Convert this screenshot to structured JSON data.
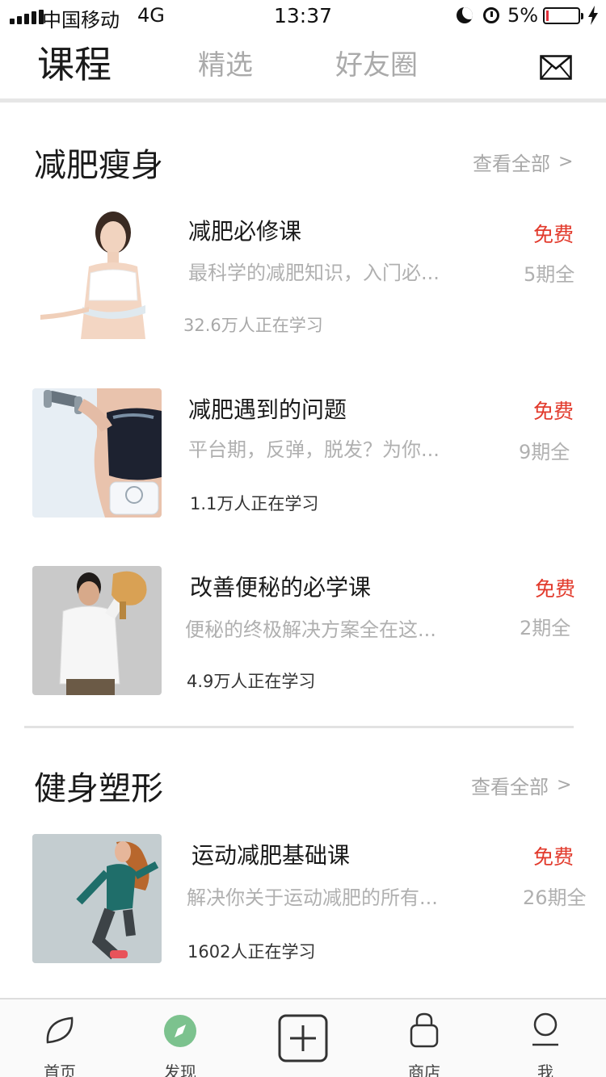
{
  "status_bar": {
    "carrier": "中国移动",
    "network": "4G",
    "time": "13:37",
    "battery_percent": "5%",
    "icons": [
      "signal-bars-icon",
      "moon-icon",
      "alarm-icon",
      "battery-icon",
      "charging-bolt-icon"
    ]
  },
  "top_nav": {
    "tabs": [
      {
        "label": "课程",
        "active": true
      },
      {
        "label": "精选",
        "active": false
      },
      {
        "label": "好友圈",
        "active": false
      }
    ],
    "mail_icon": "envelope-icon"
  },
  "sections": [
    {
      "title": "减肥瘦身",
      "see_all": "查看全部",
      "see_all_chevron": ">",
      "courses": [
        {
          "title": "减肥必修课",
          "desc": "最科学的减肥知识，入门必...",
          "learners": "32.6万人正在学习",
          "price": "免费",
          "episodes": "5期全"
        },
        {
          "title": "减肥遇到的问题",
          "desc": "平台期，反弹，脱发？为你...",
          "learners": "1.1万人正在学习",
          "price": "免费",
          "episodes": "9期全"
        },
        {
          "title": "改善便秘的必学课",
          "desc": "便秘的终极解决方案全在这...",
          "learners": "4.9万人正在学习",
          "price": "免费",
          "episodes": "2期全"
        }
      ]
    },
    {
      "title": "健身塑形",
      "see_all": "查看全部",
      "see_all_chevron": ">",
      "courses": [
        {
          "title": "运动减肥基础课",
          "desc": "解决你关于运动减肥的所有...",
          "learners": "1602人正在学习",
          "price": "免费",
          "episodes": "26期全"
        }
      ]
    }
  ],
  "bottom_nav": {
    "items": [
      {
        "label": "首页",
        "icon": "leaf-icon"
      },
      {
        "label": "发现",
        "icon": "compass-icon",
        "active": true
      },
      {
        "label": "",
        "icon": "plus-icon"
      },
      {
        "label": "商店",
        "icon": "shopping-bag-icon"
      },
      {
        "label": "我",
        "icon": "user-icon"
      }
    ]
  },
  "colors": {
    "accent_red": "#e23a2c",
    "discover_green": "#7cc28e",
    "muted_text": "#b0b0b0"
  }
}
